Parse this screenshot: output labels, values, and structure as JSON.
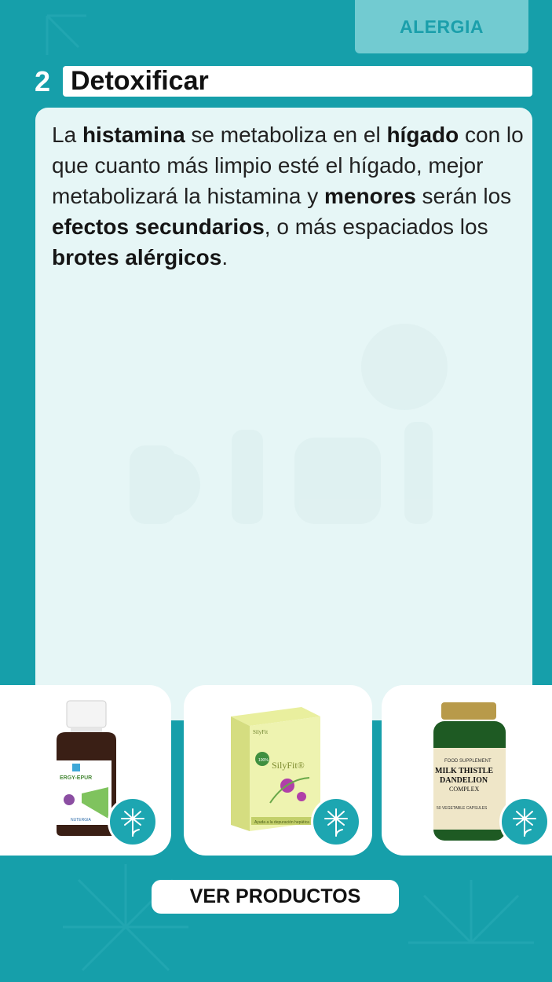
{
  "header": {
    "tag_label": "ALERGIA"
  },
  "section": {
    "number": "2",
    "title": "Detoxificar"
  },
  "content": {
    "p1": "La ",
    "b1": "histamina",
    "p2": "  se metaboliza en el ",
    "b2": "hígado",
    "p3": " con lo que cuanto más limpio esté el hígado, mejor metabolizará la histamina y ",
    "b3": "menores",
    "p4": " serán los ",
    "b4": "efectos secundarios",
    "p5": ", o más espaciados los ",
    "b5": "brotes alérgicos",
    "p6": "."
  },
  "products": [
    {
      "brand": "ERGY-EPUR",
      "maker": "NUTERGIA"
    },
    {
      "brand": "SilyFit®",
      "badge": "100% Natural",
      "caption": "Ayuda a la depuración hepática"
    },
    {
      "line1": "FOOD SUPPLEMENT",
      "line2": "MILK THISTLE",
      "line3": "DANDELION",
      "line4": "COMPLEX",
      "line5": "50 VEGETABLE CAPSULES"
    }
  ],
  "cta": {
    "label": "VER PRODUCTOS"
  },
  "colors": {
    "background": "#169faa",
    "card": "#e6f6f6",
    "tag": "#72cbd1",
    "accent": "#1da6b1"
  },
  "icons": [
    "dandelion-icon"
  ]
}
